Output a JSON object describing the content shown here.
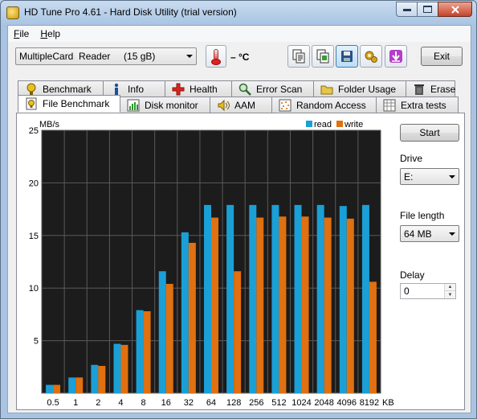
{
  "window": {
    "title": "HD Tune Pro 4.61 - Hard Disk Utility (trial version)"
  },
  "menu": [
    {
      "label": "File",
      "mnemonic": "F",
      "rest": "ile"
    },
    {
      "label": "Help",
      "mnemonic": "H",
      "rest": "elp"
    }
  ],
  "toolbar": {
    "drive_value": "MultipleCard  Reader     (15 gB)",
    "temperature": "– °C",
    "exit_label": "Exit",
    "icons": [
      "copy-text-icon",
      "copy-image-icon",
      "save-icon",
      "options-icon",
      "download-icon"
    ]
  },
  "tabs_top": [
    {
      "label": "Benchmark",
      "icon": "benchmark-icon"
    },
    {
      "label": "Info",
      "icon": "info-icon"
    },
    {
      "label": "Health",
      "icon": "health-icon"
    },
    {
      "label": "Error Scan",
      "icon": "error-scan-icon"
    },
    {
      "label": "Folder Usage",
      "icon": "folder-usage-icon"
    },
    {
      "label": "Erase",
      "icon": "erase-icon"
    }
  ],
  "tabs_bottom": [
    {
      "label": "File Benchmark",
      "icon": "file-benchmark-icon",
      "active": true
    },
    {
      "label": "Disk monitor",
      "icon": "disk-monitor-icon"
    },
    {
      "label": "AAM",
      "icon": "aam-icon"
    },
    {
      "label": "Random Access",
      "icon": "random-access-icon"
    },
    {
      "label": "Extra tests",
      "icon": "extra-tests-icon"
    }
  ],
  "side": {
    "start_label": "Start",
    "drive_label": "Drive",
    "drive_value": "E:",
    "file_length_label": "File length",
    "file_length_value": "64 MB",
    "delay_label": "Delay",
    "delay_value": "0"
  },
  "colors": {
    "read": "#1aa0d6",
    "write": "#e07010",
    "plot_bg": "#1c1c1c",
    "grid": "#5a5a5a"
  },
  "chart_data": {
    "type": "bar",
    "ylabel": "MB/s",
    "xunit": "KB",
    "ylim": [
      0,
      25
    ],
    "yticks": [
      5,
      10,
      15,
      20,
      25
    ],
    "grid": true,
    "legend_position": "top-right",
    "categories": [
      "0.5",
      "1",
      "2",
      "4",
      "8",
      "16",
      "32",
      "64",
      "128",
      "256",
      "512",
      "1024",
      "2048",
      "4096",
      "8192"
    ],
    "series": [
      {
        "name": "read",
        "values": [
          0.8,
          1.5,
          2.7,
          4.7,
          7.9,
          11.6,
          15.3,
          17.9,
          17.9,
          17.9,
          17.9,
          17.9,
          17.9,
          17.8,
          17.9
        ]
      },
      {
        "name": "write",
        "values": [
          0.8,
          1.5,
          2.6,
          4.6,
          7.8,
          10.4,
          14.3,
          16.7,
          11.6,
          16.7,
          16.8,
          16.8,
          16.7,
          16.6,
          10.6
        ]
      }
    ]
  }
}
